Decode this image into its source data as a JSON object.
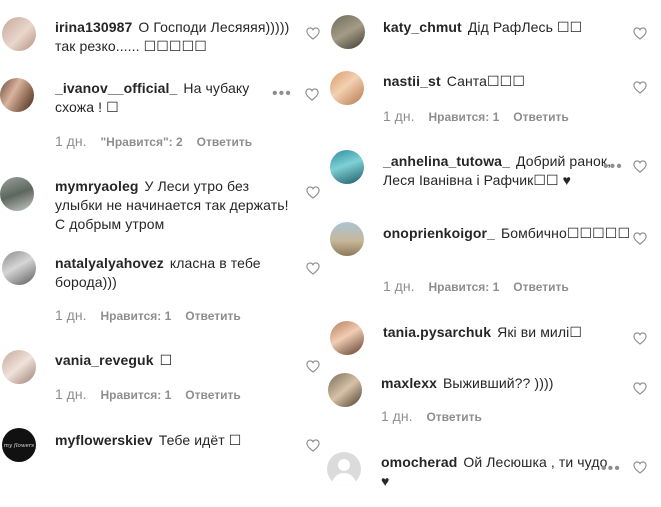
{
  "left_comments": [
    {
      "username": "irina130987",
      "text": "О Господи Лесяяяя))))) так резко...... ☐☐☐☐☐",
      "meta": null
    },
    {
      "username": "_ivanov__official_",
      "text": "На чубаку схожа ! ☐",
      "meta": {
        "time": "1 дн.",
        "likes": "\"Нравится\": 2",
        "reply": "Ответить"
      }
    },
    {
      "username": "mymryaoleg",
      "text": "У Леси утро без улыбки не начинается так держать!С добрым утром",
      "meta": null
    },
    {
      "username": "natalyalyahovez",
      "text": "класна в тебе борода)))",
      "meta": {
        "time": "1 дн.",
        "likes": "Нравится: 1",
        "reply": "Ответить"
      }
    },
    {
      "username": "vania_reveguk",
      "text": "☐",
      "meta": {
        "time": "1 дн.",
        "likes": "Нравится: 1",
        "reply": "Ответить"
      }
    },
    {
      "username": "myflowerskiev",
      "text": "Тебе идёт ☐",
      "meta": null
    }
  ],
  "right_comments": [
    {
      "username": "katy_chmut",
      "text": "Дід РафЛесь ☐☐",
      "meta": null
    },
    {
      "username": "nastii_st",
      "text": "Санта☐☐☐",
      "meta": {
        "time": "1 дн.",
        "likes": "Нравится: 1",
        "reply": "Ответить"
      }
    },
    {
      "username": "_anhelina_tutowa_",
      "text": "Добрий ранок, Леся Іванівна і Рафчик☐☐ ♥",
      "meta": null
    },
    {
      "username": "onoprienkoigor_",
      "text": "Бомбично☐☐☐☐☐",
      "meta": {
        "time": "1 дн.",
        "likes": "Нравится: 1",
        "reply": "Ответить"
      }
    },
    {
      "username": "tania.pysarchuk",
      "text": "Які ви милі☐",
      "meta": null
    },
    {
      "username": "maxlexx",
      "text": "Выживший?? ))))",
      "meta": {
        "time": "1 дн.",
        "likes": "",
        "reply": "Ответить"
      }
    },
    {
      "username": "omocherad",
      "text": "Ой Лесюшка , ти чудо ♥",
      "meta": null
    }
  ],
  "more_glyph": "•••",
  "colors": {
    "text": "#262626",
    "meta": "#8e8e8e",
    "heart_stroke": "#8e8e8e"
  }
}
